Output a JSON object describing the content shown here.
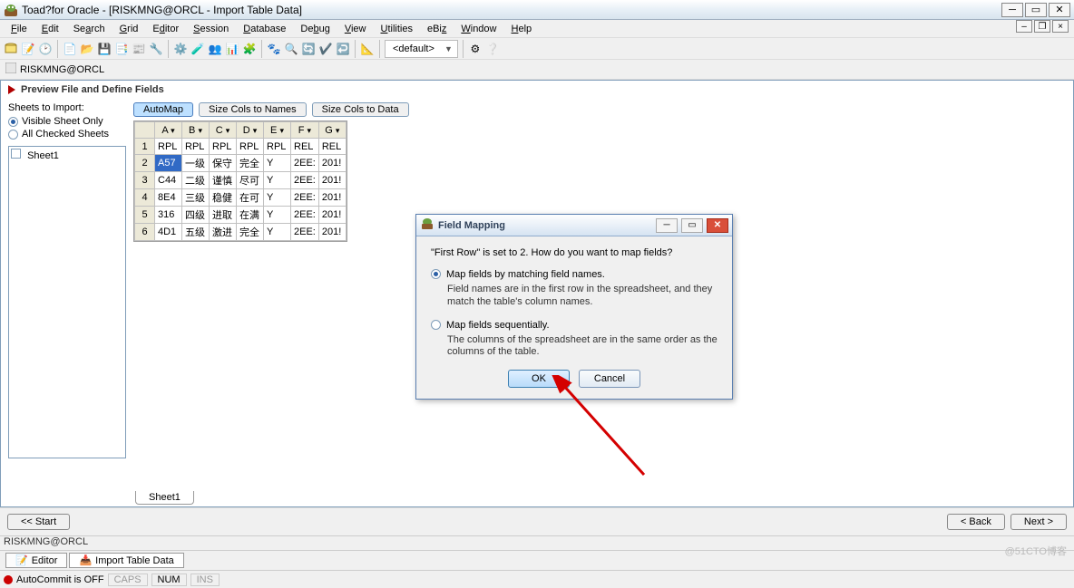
{
  "app": {
    "title": "Toad?for Oracle - [RISKMNG@ORCL - Import Table Data]"
  },
  "menus": [
    "File",
    "Edit",
    "Search",
    "Grid",
    "Editor",
    "Session",
    "Database",
    "Debug",
    "View",
    "Utilities",
    "eBiz",
    "Window",
    "Help"
  ],
  "menu_underline": [
    "F",
    "E",
    "S",
    "G",
    "d",
    "S",
    "D",
    "D",
    "V",
    "U",
    "B",
    "W",
    "H"
  ],
  "toolbar": {
    "default_label": "<default>"
  },
  "connection": {
    "text": "RISKMNG@ORCL"
  },
  "wizard": {
    "title": "Preview File and Define Fields"
  },
  "sheets_panel": {
    "label": "Sheets to Import:",
    "opt_visible": "Visible Sheet Only",
    "opt_checked": "All Checked Sheets",
    "sheet1": "Sheet1"
  },
  "buttons": {
    "automap": "AutoMap",
    "size_names": "Size Cols to Names",
    "size_data": "Size Cols to Data"
  },
  "grid": {
    "cols": [
      "A",
      "B",
      "C",
      "D",
      "E",
      "F",
      "G"
    ],
    "rows": [
      [
        "1",
        "RPL",
        "RPL",
        "RPL",
        "RPL",
        "RPL",
        "REL",
        "REL"
      ],
      [
        "2",
        "A57",
        "一级",
        "保守",
        "完全",
        "Y",
        "2EE:",
        "201!"
      ],
      [
        "3",
        "C44",
        "二级",
        "谨慎",
        "尽可",
        "Y",
        "2EE:",
        "201!"
      ],
      [
        "4",
        "8E4",
        "三级",
        "稳健",
        "在可",
        "Y",
        "2EE:",
        "201!"
      ],
      [
        "5",
        "316",
        "四级",
        "进取",
        "在满",
        "Y",
        "2EE:",
        "201!"
      ],
      [
        "6",
        "4D1",
        "五级",
        "激进",
        "完全",
        "Y",
        "2EE:",
        "201!"
      ]
    ]
  },
  "sheet_tab": "Sheet1",
  "nav": {
    "start": "<< Start",
    "back": "< Back",
    "next": "Next >"
  },
  "conn_str": "RISKMNG@ORCL",
  "bottom_tabs": {
    "editor": "Editor",
    "import": "Import Table Data"
  },
  "status": {
    "autocommit": "AutoCommit is OFF",
    "caps": "CAPS",
    "num": "NUM",
    "ins": "INS"
  },
  "modal": {
    "title": "Field Mapping",
    "question": "\"First Row\" is set to 2.  How do you want to map fields?",
    "opt1": "Map fields by matching field names.",
    "sub1": "Field names are in the first row in the spreadsheet, and they match the table's column names.",
    "opt2": "Map fields sequentially.",
    "sub2": "The columns of the spreadsheet are in the same order as the columns of the table.",
    "ok": "OK",
    "cancel": "Cancel"
  },
  "watermark": "@51CTO博客"
}
